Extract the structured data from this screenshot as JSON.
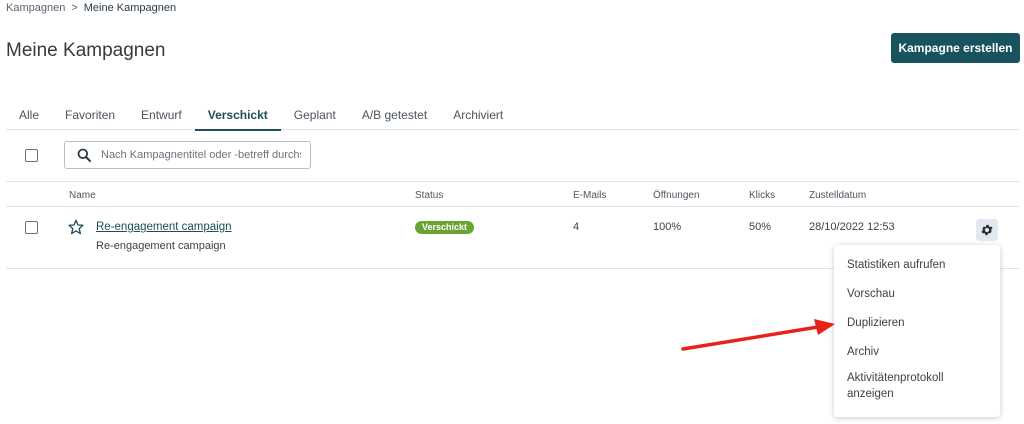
{
  "breadcrumb": {
    "parent": "Kampagnen",
    "separator": ">",
    "current": "Meine Kampagnen"
  },
  "page": {
    "title": "Meine Kampagnen",
    "create_button": "Kampagne erstellen"
  },
  "tabs": [
    {
      "label": "Alle",
      "active": false
    },
    {
      "label": "Favoriten",
      "active": false
    },
    {
      "label": "Entwurf",
      "active": false
    },
    {
      "label": "Verschickt",
      "active": true
    },
    {
      "label": "Geplant",
      "active": false
    },
    {
      "label": "A/B getestet",
      "active": false
    },
    {
      "label": "Archiviert",
      "active": false
    }
  ],
  "search": {
    "placeholder": "Nach Kampagnentitel oder -betreff durchsuchen",
    "value": ""
  },
  "table": {
    "columns": [
      "Name",
      "Status",
      "E-Mails",
      "Öffnungen",
      "Klicks",
      "Zustelldatum"
    ],
    "rows": [
      {
        "name": "Re-engagement campaign",
        "subject": "Re-engagement campaign",
        "status": "Verschickt",
        "emails": "4",
        "opens": "100%",
        "clicks": "50%",
        "delivery_date": "28/10/2022 12:53"
      }
    ]
  },
  "dropdown": {
    "items": [
      "Statistiken aufrufen",
      "Vorschau",
      "Duplizieren",
      "Archiv",
      "Aktivitätenprotokoll anzeigen"
    ]
  },
  "colors": {
    "primary": "#18535f",
    "status_sent": "#6aa532",
    "annotation_arrow": "#e8211d"
  },
  "icons": {
    "search": "search-icon",
    "favorite": "star-outline-icon",
    "settings": "gear-icon"
  }
}
